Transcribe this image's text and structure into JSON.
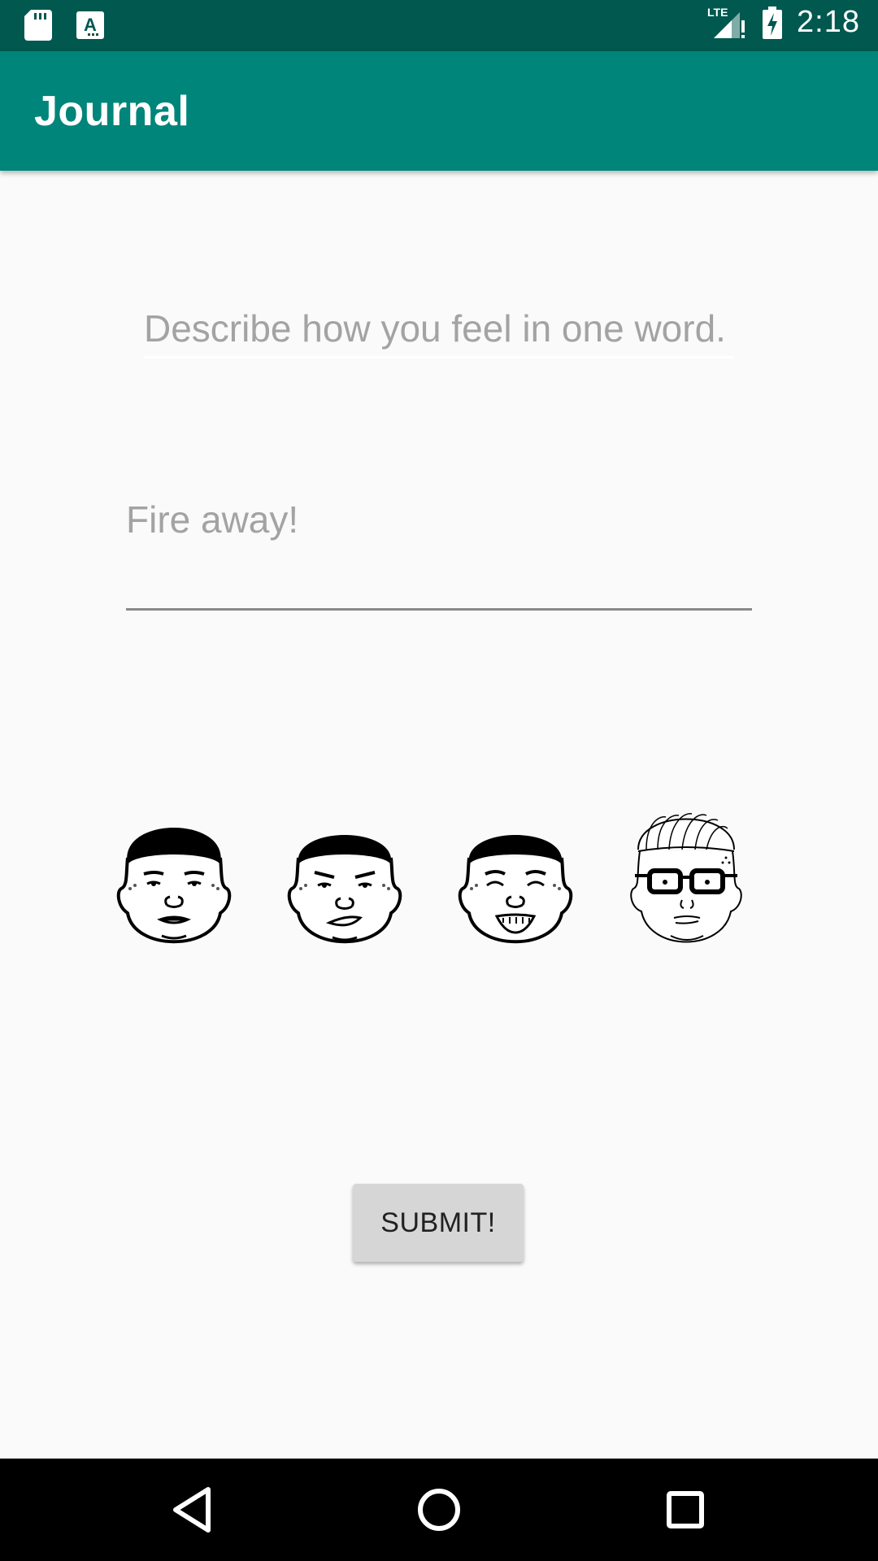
{
  "status_bar": {
    "time": "2:18",
    "icons": [
      "sd-card-icon",
      "keyboard-a-icon",
      "lte-signal-icon",
      "battery-charging-icon"
    ]
  },
  "app_bar": {
    "title": "Journal",
    "color": "#00857a"
  },
  "form": {
    "mood_placeholder": "Describe how you feel in one word.",
    "entry_placeholder": "Fire away!",
    "faces": [
      "face-neutral-icon",
      "face-smirk-icon",
      "face-laughing-icon",
      "face-glasses-icon"
    ],
    "submit_label": "SUBMIT!"
  },
  "nav_bar": {
    "icons": [
      "back-icon",
      "home-icon",
      "recents-icon"
    ]
  },
  "colors": {
    "status_bar": "#00584f",
    "app_bar": "#00857a",
    "background": "#fafafa"
  }
}
